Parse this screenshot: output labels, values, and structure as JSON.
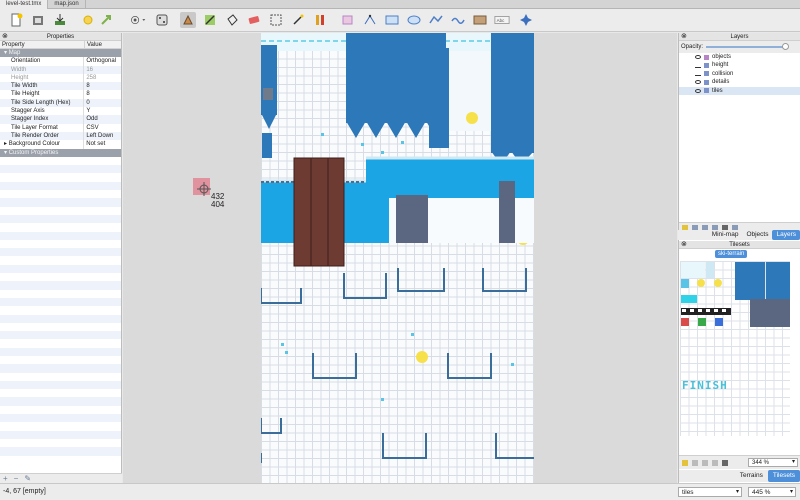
{
  "tabs": [
    {
      "label": "level-test.tmx",
      "active": true
    },
    {
      "label": "map.json",
      "active": false
    }
  ],
  "properties_panel": {
    "title": "Properties",
    "columns": {
      "property": "Property",
      "value": "Value"
    },
    "group_map": "Map",
    "rows": [
      {
        "name": "Orientation",
        "value": "Orthogonal",
        "disabled": false
      },
      {
        "name": "Width",
        "value": "16",
        "disabled": true
      },
      {
        "name": "Height",
        "value": "258",
        "disabled": true
      },
      {
        "name": "Tile Width",
        "value": "8",
        "disabled": false
      },
      {
        "name": "Tile Height",
        "value": "8",
        "disabled": false
      },
      {
        "name": "Tile Side Length (Hex)",
        "value": "0",
        "disabled": false
      },
      {
        "name": "Stagger Axis",
        "value": "Y",
        "disabled": false
      },
      {
        "name": "Stagger Index",
        "value": "Odd",
        "disabled": false
      },
      {
        "name": "Tile Layer Format",
        "value": "CSV",
        "disabled": false
      },
      {
        "name": "Tile Render Order",
        "value": "Left Down",
        "disabled": false
      },
      {
        "name": "Background Colour",
        "value": "Not set",
        "disabled": false
      }
    ],
    "group_custom": "Custom Properties"
  },
  "cursor": {
    "x_readout": "432",
    "y_readout": "404"
  },
  "layers_panel": {
    "title": "Layers",
    "opacity_label": "Opacity:",
    "layers": [
      {
        "name": "objects",
        "visible": true,
        "type": "object"
      },
      {
        "name": "height",
        "visible": false,
        "type": "tile"
      },
      {
        "name": "collision",
        "visible": false,
        "type": "tile"
      },
      {
        "name": "details",
        "visible": true,
        "type": "tile"
      },
      {
        "name": "tiles",
        "visible": true,
        "type": "tile",
        "selected": true
      }
    ],
    "tabs": [
      "Mini-map",
      "Objects",
      "Layers"
    ],
    "active_tab": "Layers"
  },
  "tilesets_panel": {
    "title": "Tilesets",
    "tileset_tab": "ski-terrain",
    "finish_text": "FINISH",
    "zoom": "344 %",
    "tabs": [
      "Terrains",
      "Tilesets"
    ],
    "active_tab": "Tilesets"
  },
  "status": {
    "position": "-4, 67 [empty]",
    "layer_select": "tiles",
    "zoom_select": "445 %"
  },
  "colors": {
    "accent": "#4d8fd9",
    "snow": "#fafbfd",
    "water": "#1ba5e5",
    "tree": "#2c78b8",
    "log": "#6e3b32",
    "rock": "#5b6781",
    "coin": "#f7e14a"
  }
}
